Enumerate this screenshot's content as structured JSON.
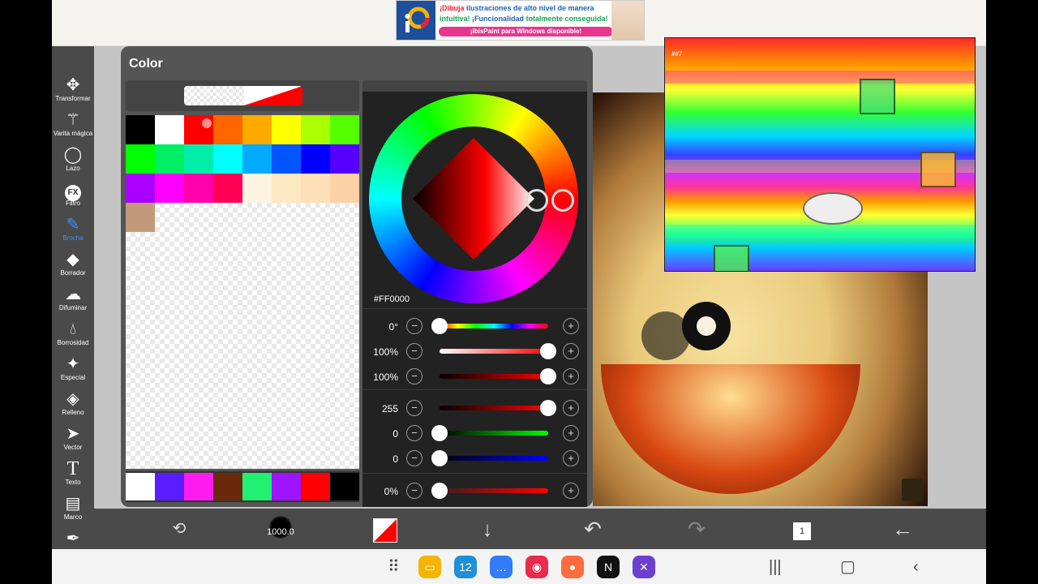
{
  "ad": {
    "line1_a": "¡Dibuja ",
    "line1_b": "ilustraciones de alto nivel de manera",
    "line2_a": "intuitiva! ",
    "line2_b": "¡Funcionalidad ",
    "line2_c": "totalmente conseguida!",
    "pill": "¡ibisPaint para Windows disponible!"
  },
  "tools": [
    {
      "label": "Transformar",
      "icon": "move-arrows-icon"
    },
    {
      "label": "Varita mágica",
      "icon": "magic-wand-icon"
    },
    {
      "label": "Lazo",
      "icon": "lasso-icon"
    },
    {
      "label": "Filtro",
      "icon": "fx-icon"
    },
    {
      "label": "Brocha",
      "icon": "brush-icon",
      "active": true
    },
    {
      "label": "Borrador",
      "icon": "eraser-icon"
    },
    {
      "label": "Difuminar",
      "icon": "smudge-icon"
    },
    {
      "label": "Borrosidad",
      "icon": "blur-drop-icon"
    },
    {
      "label": "Especial",
      "icon": "special-sparkle-icon"
    },
    {
      "label": "Relleno",
      "icon": "fill-bucket-icon"
    },
    {
      "label": "Vector",
      "icon": "vector-arrow-icon"
    },
    {
      "label": "Texto",
      "icon": "text-icon"
    },
    {
      "label": "Marco",
      "icon": "frame-icon"
    },
    {
      "label": "",
      "icon": "eyedropper-icon"
    }
  ],
  "panel": {
    "title": "Color",
    "hex": "#FF0000",
    "sliders_hsb": [
      {
        "value": "0°",
        "fraction": 0.0
      },
      {
        "value": "100%",
        "fraction": 1.0
      },
      {
        "value": "100%",
        "fraction": 1.0
      }
    ],
    "sliders_rgb": [
      {
        "value": "255",
        "fraction": 1.0
      },
      {
        "value": "0",
        "fraction": 0.0
      },
      {
        "value": "0",
        "fraction": 0.0
      }
    ],
    "opacity": {
      "value": "0%",
      "fraction": 0.0
    }
  },
  "palette_colors": [
    "#000000",
    "#ffffff",
    "#ff0000",
    "#ff6600",
    "#ffaa00",
    "#ffff00",
    "#aaff00",
    "#55ff00",
    "#00ff00",
    "#00ee66",
    "#00eeaa",
    "#00ffff",
    "#00aaff",
    "#0055ff",
    "#0000ff",
    "#5500ff",
    "#aa00ff",
    "#ff00ff",
    "#ff00aa",
    "#ff0055",
    "#fdf3e1",
    "#fde8c2",
    "#fde0b8",
    "#fcd1a5",
    "#c19a7a"
  ],
  "recent_colors": [
    "#ffffff",
    "#5b1cff",
    "#ff1cf0",
    "#6a2a0a",
    "#22f070",
    "#9e14ff",
    "#ff0000",
    "#000000"
  ],
  "bottom": {
    "brush_size": "1000.0"
  },
  "overlay": {
    "title": "##7"
  },
  "apps": [
    {
      "name": "files-app-icon",
      "color": "#f5b400",
      "glyph": "▭"
    },
    {
      "name": "calendar-app-icon",
      "color": "#1e8fd8",
      "glyph": "12"
    },
    {
      "name": "messages-app-icon",
      "color": "#2f7cf6",
      "glyph": "…"
    },
    {
      "name": "camera-app-icon",
      "color": "#ea2a4e",
      "glyph": "◉"
    },
    {
      "name": "contacts-app-icon",
      "color": "#ff6b3d",
      "glyph": "●"
    },
    {
      "name": "netflix-app-icon",
      "color": "#111111",
      "glyph": "N"
    },
    {
      "name": "game-launcher-app-icon",
      "color": "#6b3fd0",
      "glyph": "✕"
    }
  ]
}
